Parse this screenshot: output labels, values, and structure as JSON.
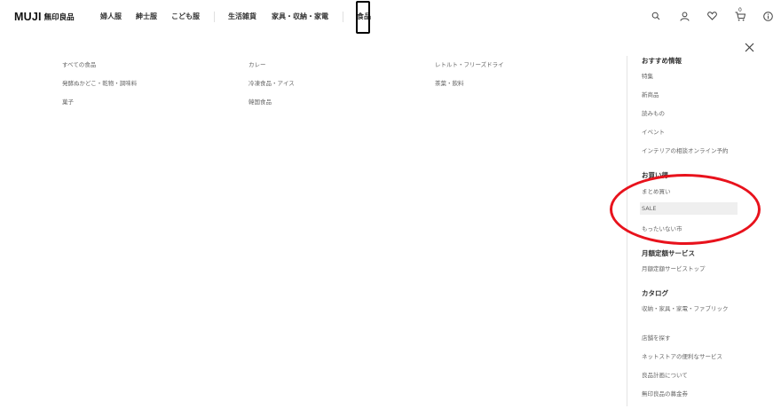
{
  "header": {
    "logo_latin": "MUJI",
    "logo_jp": "無印良品",
    "nav": [
      "婦人服",
      "紳士服",
      "こども服",
      "生活雑貨",
      "家具・収納・家電",
      "食品"
    ],
    "cart_count": "0"
  },
  "categories": {
    "col1": [
      "すべての食品",
      "発酵ぬかどこ・乾物・調味料",
      "菓子"
    ],
    "col2": [
      "カレー",
      "冷凍食品・アイス",
      "韓国食品"
    ],
    "col3": [
      "レトルト・フリーズドライ",
      "茶葉・飲料"
    ]
  },
  "sidebar": {
    "section1": {
      "title": "おすすめ情報",
      "links": [
        "特集",
        "新商品",
        "読みもの",
        "イベント",
        "インテリアの相談オンライン予約"
      ]
    },
    "section2": {
      "title": "お買い得",
      "links": [
        "まとめ買い",
        "SALE",
        "もったいない市"
      ]
    },
    "section3": {
      "title": "月額定額サービス",
      "links": [
        "月額定額サービストップ"
      ]
    },
    "section4": {
      "title": "カタログ",
      "links": [
        "収納・家具・家電・ファブリック"
      ]
    },
    "footer_links": [
      "店舗を探す",
      "ネットストアの便利なサービス",
      "良品計画について",
      "無印良品の募金券"
    ]
  },
  "colors": {
    "annotation_red": "#e8121c",
    "text_dark": "#333333",
    "text_link": "#666666"
  }
}
